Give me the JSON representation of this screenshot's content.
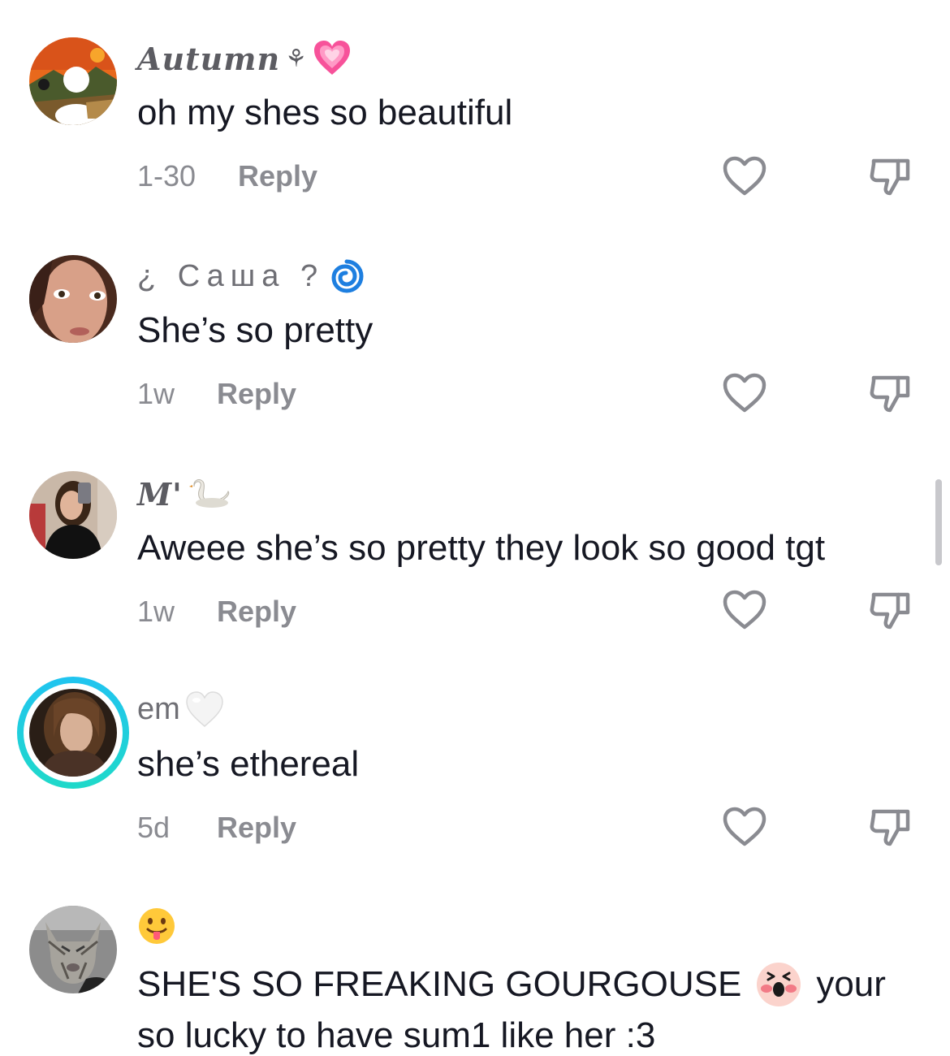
{
  "comments": [
    {
      "username": "Autumn",
      "username_suffix": "⚘",
      "username_emoji": "sparkling-heart",
      "text": "oh my shes so beautiful",
      "time": "1-30",
      "reply_label": "Reply"
    },
    {
      "username": "¿ Саша ?",
      "username_emoji": "cyclone",
      "text": "She’s so pretty",
      "time": "1w",
      "reply_label": "Reply"
    },
    {
      "username": "M'",
      "username_emoji": "swan",
      "text": "Aweee she’s so pretty they look so good tgt",
      "time": "1w",
      "reply_label": "Reply"
    },
    {
      "username": "em",
      "username_emoji": "white-heart",
      "text": "she’s ethereal",
      "time": "5d",
      "reply_label": "Reply"
    },
    {
      "username_emoji": "tongue-face",
      "text_line1_a": "SHE'S SO FREAKING GOURGOUSE",
      "text_line1_b": "your",
      "text_line2": "so lucky to have sum1 like her :3"
    }
  ]
}
